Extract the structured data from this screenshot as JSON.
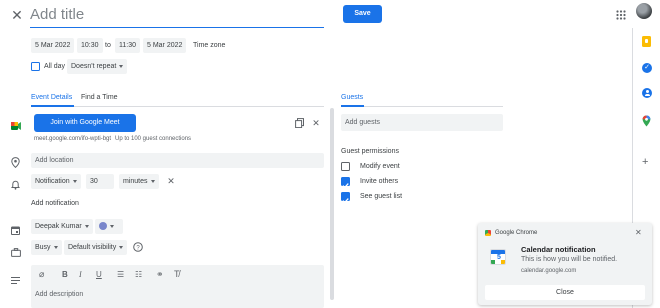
{
  "header": {
    "title_placeholder": "Add title",
    "save_label": "Save"
  },
  "datetime": {
    "start_date": "5 Mar 2022",
    "start_time": "10:30",
    "to": "to",
    "end_time": "11:30",
    "end_date": "5 Mar 2022",
    "timezone_label": "Time zone",
    "all_day_label": "All day",
    "repeat_label": "Doesn't repeat"
  },
  "tabs": {
    "event_details": "Event Details",
    "find_time": "Find a Time"
  },
  "meet": {
    "join_label": "Join with Google Meet",
    "link": "meet.google.com/ifo-wpti-bgt",
    "limit": "Up to 100 guest connections"
  },
  "location": {
    "placeholder": "Add location"
  },
  "notification": {
    "type": "Notification",
    "value": "30",
    "unit": "minutes",
    "add_label": "Add notification"
  },
  "owner": {
    "name": "Deepak Kumar",
    "color": "#7986cb"
  },
  "availability": {
    "busy": "Busy",
    "visibility": "Default visibility"
  },
  "description": {
    "placeholder": "Add description"
  },
  "guests": {
    "tab_label": "Guests",
    "placeholder": "Add guests",
    "permissions_title": "Guest permissions",
    "permissions": [
      {
        "label": "Modify event",
        "checked": false
      },
      {
        "label": "Invite others",
        "checked": true
      },
      {
        "label": "See guest list",
        "checked": true
      }
    ]
  },
  "notification_toast": {
    "app": "Google Chrome",
    "title": "Calendar notification",
    "body": "This is how you will be notified.",
    "source": "calendar.google.com",
    "close_label": "Close"
  },
  "colors": {
    "accent": "#1a73e8",
    "keep": "#fbbc04",
    "maps": "#34a853"
  }
}
